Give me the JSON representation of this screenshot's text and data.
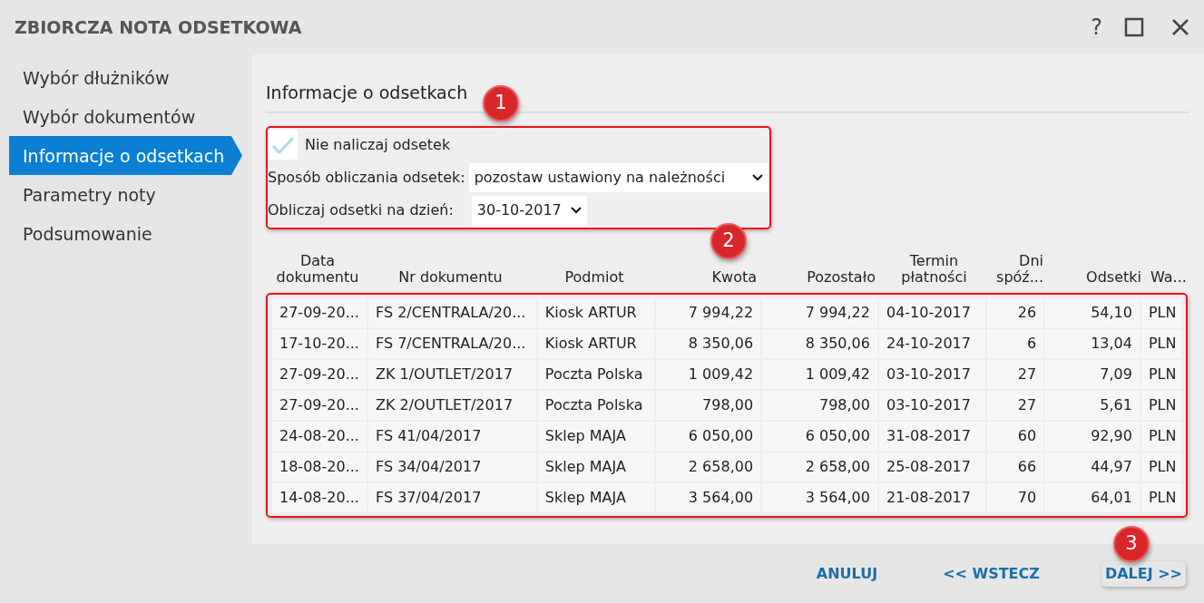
{
  "window": {
    "title": "ZBIORCZA NOTA ODSETKOWA",
    "help": "?"
  },
  "sidebar": {
    "items": [
      {
        "label": "Wybór dłużników",
        "selected": false
      },
      {
        "label": "Wybór dokumentów",
        "selected": false
      },
      {
        "label": "Informacje o odsetkach",
        "selected": true
      },
      {
        "label": "Parametry noty",
        "selected": false
      },
      {
        "label": "Podsumowanie",
        "selected": false
      }
    ]
  },
  "section": {
    "title": "Informacje o odsetkach"
  },
  "options": {
    "checkbox": {
      "label": "Nie naliczaj odsetek",
      "checked": true
    },
    "method": {
      "label": "Sposób obliczania odsetek:",
      "value": "pozostaw ustawiony na należności"
    },
    "date": {
      "label": "Obliczaj odsetki na dzień:",
      "value": "30-10-2017"
    }
  },
  "table": {
    "columns": [
      {
        "label": "Data dokumentu",
        "kind": "text"
      },
      {
        "label": "Nr dokumentu",
        "kind": "text"
      },
      {
        "label": "Podmiot",
        "kind": "text"
      },
      {
        "label": "Kwota",
        "kind": "number"
      },
      {
        "label": "Pozostało",
        "kind": "number"
      },
      {
        "label": "Termin płatności",
        "kind": "text"
      },
      {
        "label": "Dni spóź...",
        "kind": "number"
      },
      {
        "label": "Odsetki",
        "kind": "number"
      },
      {
        "label": "Wa...",
        "kind": "text"
      }
    ],
    "rows": [
      [
        "27-09-20...",
        "FS 2/CENTRALA/20...",
        "Kiosk ARTUR",
        "7 994,22",
        "7 994,22",
        "04-10-2017",
        "26",
        "54,10",
        "PLN"
      ],
      [
        "17-10-20...",
        "FS 7/CENTRALA/20...",
        "Kiosk ARTUR",
        "8 350,06",
        "8 350,06",
        "24-10-2017",
        "6",
        "13,04",
        "PLN"
      ],
      [
        "27-09-20...",
        "ZK 1/OUTLET/2017",
        "Poczta Polska",
        "1 009,42",
        "1 009,42",
        "03-10-2017",
        "27",
        "7,09",
        "PLN"
      ],
      [
        "27-09-20...",
        "ZK 2/OUTLET/2017",
        "Poczta Polska",
        "798,00",
        "798,00",
        "03-10-2017",
        "27",
        "5,61",
        "PLN"
      ],
      [
        "24-08-20...",
        "FS 41/04/2017",
        "Sklep MAJA",
        "6 050,00",
        "6 050,00",
        "31-08-2017",
        "60",
        "92,90",
        "PLN"
      ],
      [
        "18-08-20...",
        "FS 34/04/2017",
        "Sklep MAJA",
        "2 658,00",
        "2 658,00",
        "25-08-2017",
        "66",
        "44,97",
        "PLN"
      ],
      [
        "14-08-20...",
        "FS 37/04/2017",
        "Sklep MAJA",
        "3 564,00",
        "3 564,00",
        "21-08-2017",
        "70",
        "64,01",
        "PLN"
      ]
    ]
  },
  "footer": {
    "buttons": [
      "ANULUJ",
      "<< WSTECZ",
      "DALEJ >>"
    ]
  },
  "callouts": [
    "1",
    "2",
    "3"
  ]
}
